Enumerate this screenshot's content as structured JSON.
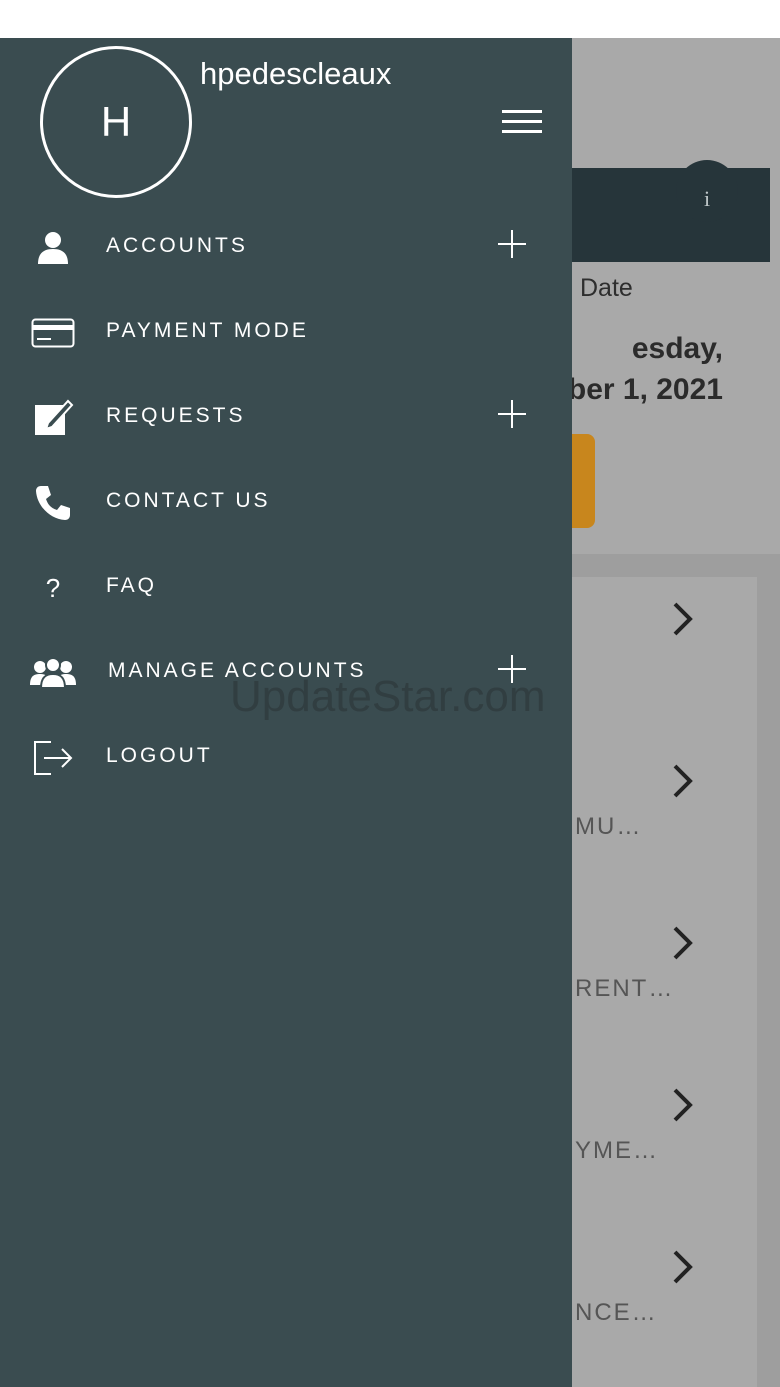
{
  "drawer": {
    "avatar_initial": "H",
    "username": "hpedescleaux",
    "items": [
      {
        "label": "ACCOUNTS",
        "icon": "user-icon"
      },
      {
        "label": "PAYMENT MODE",
        "icon": "credit-card-icon"
      },
      {
        "label": "REQUESTS",
        "icon": "edit-icon"
      },
      {
        "label": "CONTACT US",
        "icon": "phone-icon"
      },
      {
        "label": "FAQ",
        "icon": "question-icon",
        "glyph": "?"
      },
      {
        "label": "MANAGE ACCOUNTS",
        "icon": "users-icon"
      },
      {
        "label": "LOGOUT",
        "icon": "logout-icon"
      }
    ]
  },
  "background": {
    "info_glyph": "i",
    "date_label": "Date",
    "date_line1": "esday,",
    "date_line2": "ber 1, 2021",
    "rows": [
      "",
      "MU…",
      "RENT…",
      "YME…",
      "NCE…"
    ]
  },
  "watermark": "UpdateStar.com",
  "colors": {
    "drawer": "#3a4c50",
    "accent_orange": "#c8861d",
    "banner": "#26353a"
  }
}
